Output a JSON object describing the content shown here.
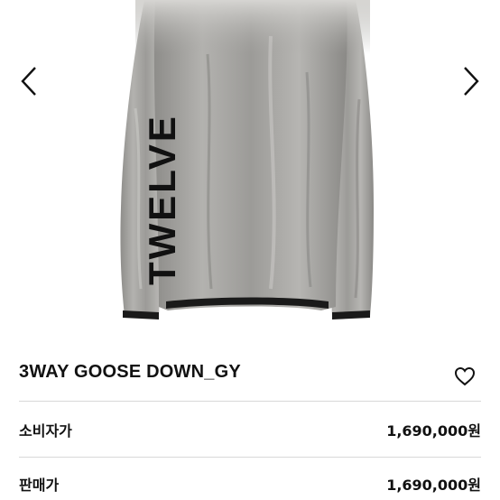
{
  "gallery": {
    "prev_icon": "chevron-left-icon",
    "next_icon": "chevron-right-icon",
    "image_print_text": "TWELVE"
  },
  "product": {
    "title": "3WAY GOOSE DOWN_GY",
    "wishlist_icon": "heart-outline-icon"
  },
  "prices": [
    {
      "label": "소비자가",
      "value": "1,690,000원"
    },
    {
      "label": "판매가",
      "value": "1,690,000원"
    }
  ],
  "colors": {
    "jacket": "#a9a8a5",
    "jacket_shadow": "#6f6e6b",
    "print": "#111111",
    "divider": "#d8d8d8"
  }
}
